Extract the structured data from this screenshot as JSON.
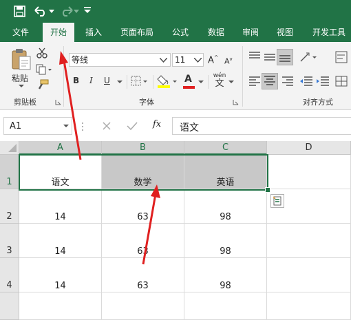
{
  "quick_access": {
    "save_icon": "save-icon",
    "undo_icon": "undo-icon",
    "redo_icon": "redo-icon",
    "customize_icon": "customize-icon"
  },
  "tabs": [
    "文件",
    "开始",
    "插入",
    "页面布局",
    "公式",
    "数据",
    "审阅",
    "视图",
    "开发工具"
  ],
  "active_tab": "开始",
  "ribbon": {
    "clipboard": {
      "paste": "粘贴",
      "label": "剪贴板"
    },
    "font": {
      "name": "等线",
      "size": "11",
      "bold": "B",
      "italic": "I",
      "underline": "U",
      "color_a": "A",
      "wen": "wén",
      "wen_char": "文",
      "label": "字体",
      "grow": "A",
      "shrink": "A"
    },
    "alignment": {
      "label": "对齐方式"
    }
  },
  "formula_bar": {
    "name_box": "A1",
    "fx": "fx",
    "content": "语文"
  },
  "grid": {
    "columns": [
      "A",
      "B",
      "C",
      "D"
    ],
    "rows": [
      "1",
      "2",
      "3",
      "4"
    ],
    "cells": [
      [
        "语文",
        "数学",
        "英语",
        ""
      ],
      [
        "14",
        "63",
        "98",
        ""
      ],
      [
        "14",
        "63",
        "98",
        ""
      ],
      [
        "14",
        "63",
        "98",
        ""
      ]
    ]
  },
  "colors": {
    "excel_green": "#217346",
    "arrow_red": "#e02020",
    "highlight": "#c8c8c8"
  }
}
